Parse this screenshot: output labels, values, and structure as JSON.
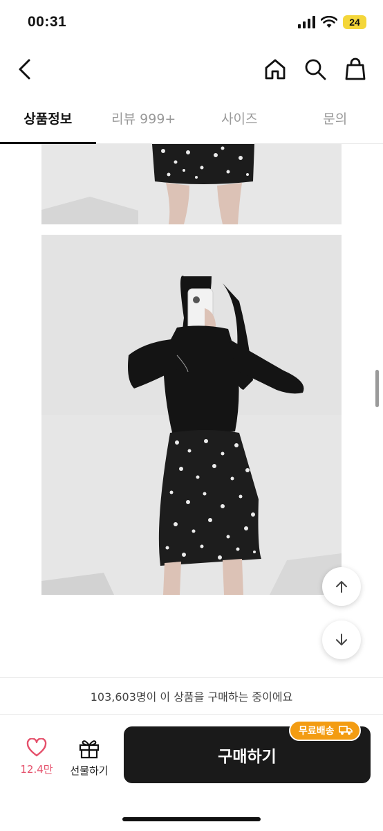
{
  "status": {
    "time": "00:31",
    "battery": "24"
  },
  "tabs": [
    {
      "label": "상품정보",
      "active": true
    },
    {
      "label": "리뷰 999+",
      "active": false
    },
    {
      "label": "사이즈",
      "active": false
    },
    {
      "label": "문의",
      "active": false
    }
  ],
  "icons": {
    "back": "chevron-left-icon",
    "home": "home-icon",
    "search": "search-icon",
    "cart": "shopping-bag-icon",
    "scroll_up": "arrow-up-icon",
    "scroll_down": "arrow-down-icon",
    "like": "heart-icon",
    "gift": "gift-icon",
    "truck": "truck-icon"
  },
  "buyers_text": "103,603명이 이 상품을 구매하는 중이에요",
  "bottom": {
    "like_count": "12.4만",
    "gift_label": "선물하기",
    "buy_label": "구매하기",
    "free_shipping_badge": "무료배송"
  },
  "colors": {
    "accent_like": "#e5506b",
    "badge": "#f39c12",
    "buy_button": "#1a1a1a",
    "battery": "#f4d63a"
  }
}
